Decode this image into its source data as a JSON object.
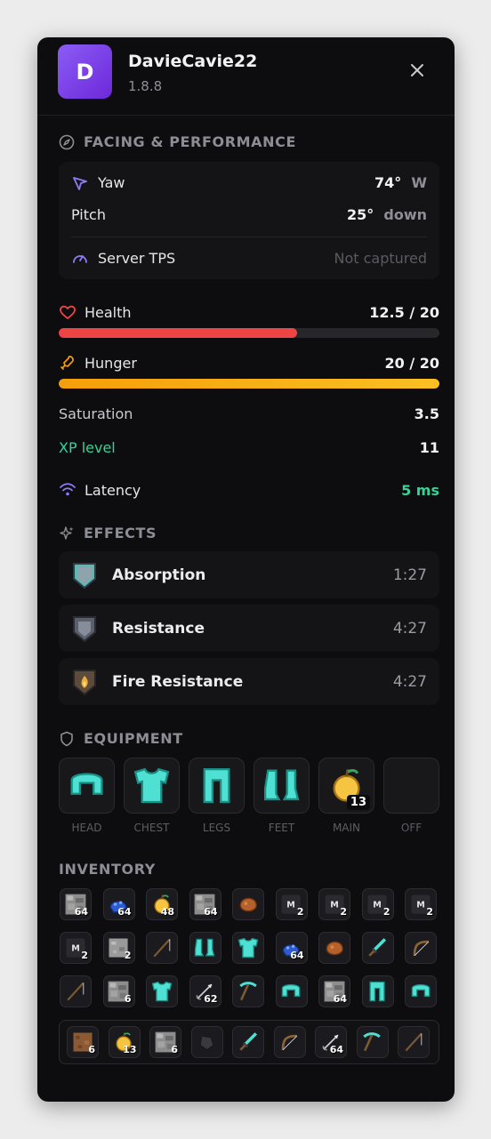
{
  "header": {
    "avatar_letter": "D",
    "username": "DavieCavie22",
    "version": "1.8.8"
  },
  "facing": {
    "title": "FACING & PERFORMANCE",
    "yaw_label": "Yaw",
    "yaw_value": "74°",
    "yaw_dir": "W",
    "pitch_label": "Pitch",
    "pitch_value": "25°",
    "pitch_dir": "down",
    "tps_label": "Server TPS",
    "tps_value": "Not captured"
  },
  "stats": {
    "health_label": "Health",
    "health_value": "12.5 / 20",
    "health_fraction": 0.625,
    "health_color": "#ef4444",
    "hunger_label": "Hunger",
    "hunger_value": "20 / 20",
    "hunger_fraction": 1.0,
    "hunger_color": "#f59e0b",
    "saturation_label": "Saturation",
    "saturation_value": "3.5",
    "xp_label": "XP level",
    "xp_value": "11",
    "xp_color": "#34d399",
    "latency_label": "Latency",
    "latency_value": "5 ms",
    "latency_color": "#34d399"
  },
  "effects": {
    "title": "EFFECTS",
    "items": [
      {
        "name": "Absorption",
        "time": "1:27",
        "icon": "absorption-icon"
      },
      {
        "name": "Resistance",
        "time": "4:27",
        "icon": "resistance-icon"
      },
      {
        "name": "Fire Resistance",
        "time": "4:27",
        "icon": "fire-resistance-icon"
      }
    ]
  },
  "equipment": {
    "title": "EQUIPMENT",
    "slots": [
      {
        "label": "HEAD",
        "item": "diamond-helmet",
        "count": ""
      },
      {
        "label": "CHEST",
        "item": "diamond-chestplate",
        "count": ""
      },
      {
        "label": "LEGS",
        "item": "diamond-leggings",
        "count": ""
      },
      {
        "label": "FEET",
        "item": "diamond-boots",
        "count": ""
      },
      {
        "label": "MAIN",
        "item": "golden-apple",
        "count": "13"
      },
      {
        "label": "OFF",
        "item": "",
        "count": ""
      }
    ]
  },
  "inventory": {
    "title": "INVENTORY",
    "rows": [
      [
        {
          "item": "cobblestone",
          "count": "64"
        },
        {
          "item": "lapis",
          "count": "64"
        },
        {
          "item": "golden-apple",
          "count": "48"
        },
        {
          "item": "cobblestone",
          "count": "64"
        },
        {
          "item": "cooked-meat",
          "count": ""
        },
        {
          "item": "music-disc",
          "count": "2"
        },
        {
          "item": "music-disc",
          "count": "2"
        },
        {
          "item": "music-disc",
          "count": "2"
        },
        {
          "item": "music-disc",
          "count": "2"
        }
      ],
      [
        {
          "item": "music-disc",
          "count": "2"
        },
        {
          "item": "stone",
          "count": "2"
        },
        {
          "item": "fishing-rod",
          "count": ""
        },
        {
          "item": "diamond-boots",
          "count": ""
        },
        {
          "item": "diamond-chestplate",
          "count": ""
        },
        {
          "item": "lapis",
          "count": "64"
        },
        {
          "item": "cooked-meat",
          "count": ""
        },
        {
          "item": "diamond-sword",
          "count": ""
        },
        {
          "item": "bow",
          "count": ""
        }
      ],
      [
        {
          "item": "fishing-rod",
          "count": ""
        },
        {
          "item": "cobblestone",
          "count": "6"
        },
        {
          "item": "diamond-chestplate",
          "count": ""
        },
        {
          "item": "arrow",
          "count": "62"
        },
        {
          "item": "diamond-pickaxe",
          "count": ""
        },
        {
          "item": "diamond-helmet",
          "count": ""
        },
        {
          "item": "cobblestone",
          "count": "64"
        },
        {
          "item": "diamond-leggings",
          "count": ""
        },
        {
          "item": "diamond-helmet",
          "count": ""
        }
      ]
    ],
    "hotbar": [
      {
        "item": "dirt",
        "count": "6"
      },
      {
        "item": "golden-apple",
        "count": "13"
      },
      {
        "item": "cobblestone",
        "count": "6"
      },
      {
        "item": "flint",
        "count": ""
      },
      {
        "item": "diamond-sword",
        "count": ""
      },
      {
        "item": "bow",
        "count": ""
      },
      {
        "item": "arrow",
        "count": "64"
      },
      {
        "item": "diamond-pickaxe",
        "count": ""
      },
      {
        "item": "fishing-rod",
        "count": ""
      }
    ]
  }
}
